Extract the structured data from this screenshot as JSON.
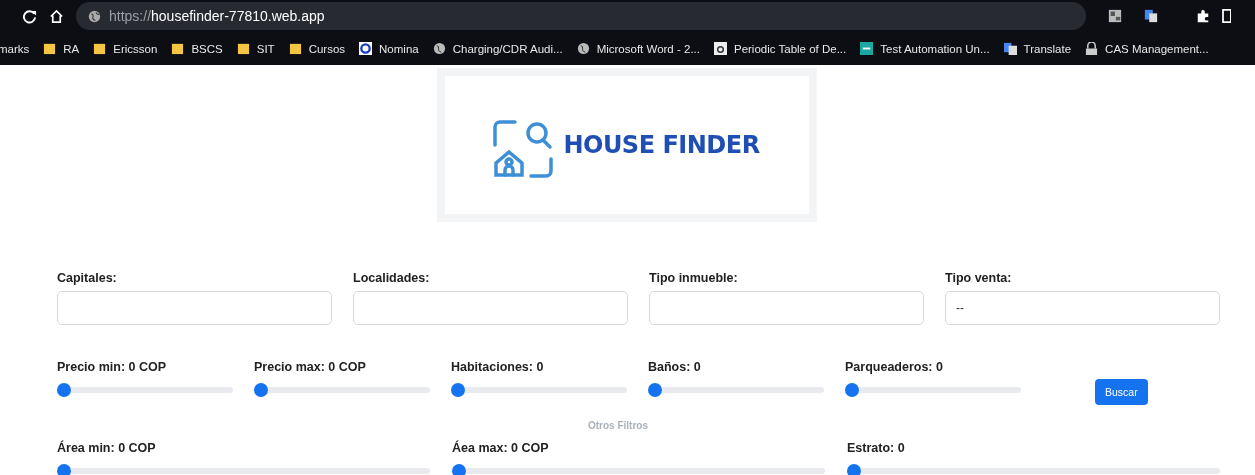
{
  "browser": {
    "url_scheme": "https://",
    "url_host": "housefinder-77810.web.app"
  },
  "bookmarks": [
    {
      "label": "marks",
      "kind": "text"
    },
    {
      "label": "RA",
      "kind": "folder"
    },
    {
      "label": "Ericsson",
      "kind": "folder"
    },
    {
      "label": "BSCS",
      "kind": "folder"
    },
    {
      "label": "SIT",
      "kind": "folder"
    },
    {
      "label": "Cursos",
      "kind": "folder"
    },
    {
      "label": "Nomina",
      "kind": "app"
    },
    {
      "label": "Charging/CDR Audi...",
      "kind": "globe"
    },
    {
      "label": "Microsoft Word - 2...",
      "kind": "globe"
    },
    {
      "label": "Periodic Table of De...",
      "kind": "doc"
    },
    {
      "label": "Test Automation Un...",
      "kind": "tile"
    },
    {
      "label": "Translate",
      "kind": "translate"
    },
    {
      "label": "CAS Management...",
      "kind": "lock"
    }
  ],
  "logo": {
    "text": "HOUSE FINDER"
  },
  "fields": [
    {
      "label": "Capitales:"
    },
    {
      "label": "Localidades:"
    },
    {
      "label": "Tipo inmueble:"
    },
    {
      "label": "Tipo venta:",
      "value": "--"
    }
  ],
  "sliders": [
    {
      "label": "Precio min: 0 COP",
      "level": 0
    },
    {
      "label": "Precio max: 0 COP",
      "level": 0
    },
    {
      "label": "Habitaciones: 0",
      "level": 0
    },
    {
      "label": "Baños: 0",
      "level": 0
    },
    {
      "label": "Parqueaderos: 0",
      "level": 0
    }
  ],
  "search_button": "Buscar",
  "more_filters": "Otros Filtros",
  "extra_sliders": [
    {
      "label": "Área min: 0 COP",
      "level": 0
    },
    {
      "label": "Áea max: 0 COP",
      "level": 0
    },
    {
      "label": "Estrato: 0",
      "level": 0
    }
  ]
}
